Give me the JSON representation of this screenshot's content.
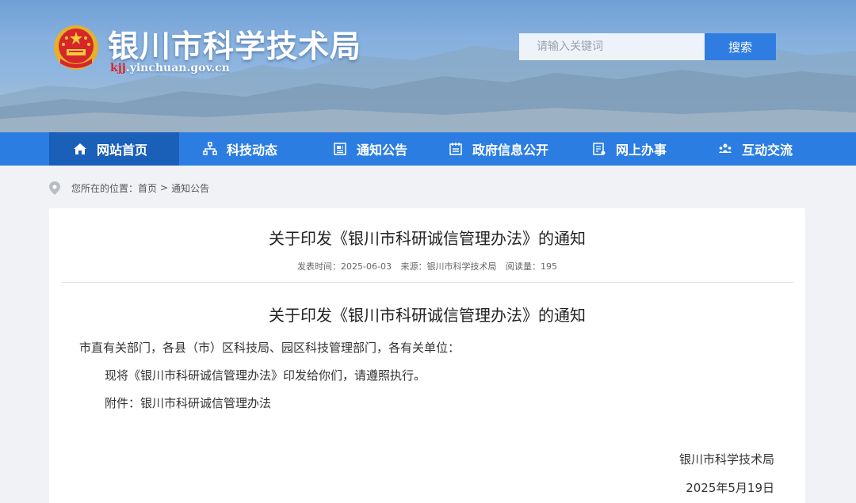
{
  "header": {
    "site_title": "银川市科学技术局",
    "domain_prefix": "kjj",
    "domain_rest": ".yinchuan.gov.cn",
    "search_placeholder": "请输入关键词",
    "search_button": "搜索",
    "emblem_icon": "national-emblem-icon"
  },
  "nav": {
    "items": [
      {
        "label": "网站首页",
        "icon": "home-icon"
      },
      {
        "label": "科技动态",
        "icon": "network-icon"
      },
      {
        "label": "通知公告",
        "icon": "notice-icon"
      },
      {
        "label": "政府信息公开",
        "icon": "calendar-doc-icon"
      },
      {
        "label": "网上办事",
        "icon": "form-icon"
      },
      {
        "label": "互动交流",
        "icon": "people-icon"
      }
    ],
    "active_index": 0
  },
  "breadcrumb": {
    "prefix": "您所在的位置：",
    "home": "首页",
    "separator": ">",
    "current": "通知公告"
  },
  "article": {
    "title": "关于印发《银川市科研诚信管理办法》的通知",
    "meta": {
      "publish_time": "发表时间：2025-06-03",
      "source": "来源：银川市科学技术局",
      "views": "阅读量：195"
    },
    "doc_title": "关于印发《银川市科研诚信管理办法》的通知",
    "salutation": "市直有关部门，各县（市）区科技局、园区科技管理部门，各有关单位：",
    "body": "现将《银川市科研诚信管理办法》印发给你们，请遵照执行。",
    "attachment": "附件：银川市科研诚信管理办法",
    "signature_org": "银川市科学技术局",
    "signature_date": "2025年5月19日"
  },
  "colors": {
    "nav_bg": "#2b7de2",
    "nav_active": "#1a5fb8",
    "search_button": "#2f7de1",
    "domain_highlight": "#d8252a"
  }
}
